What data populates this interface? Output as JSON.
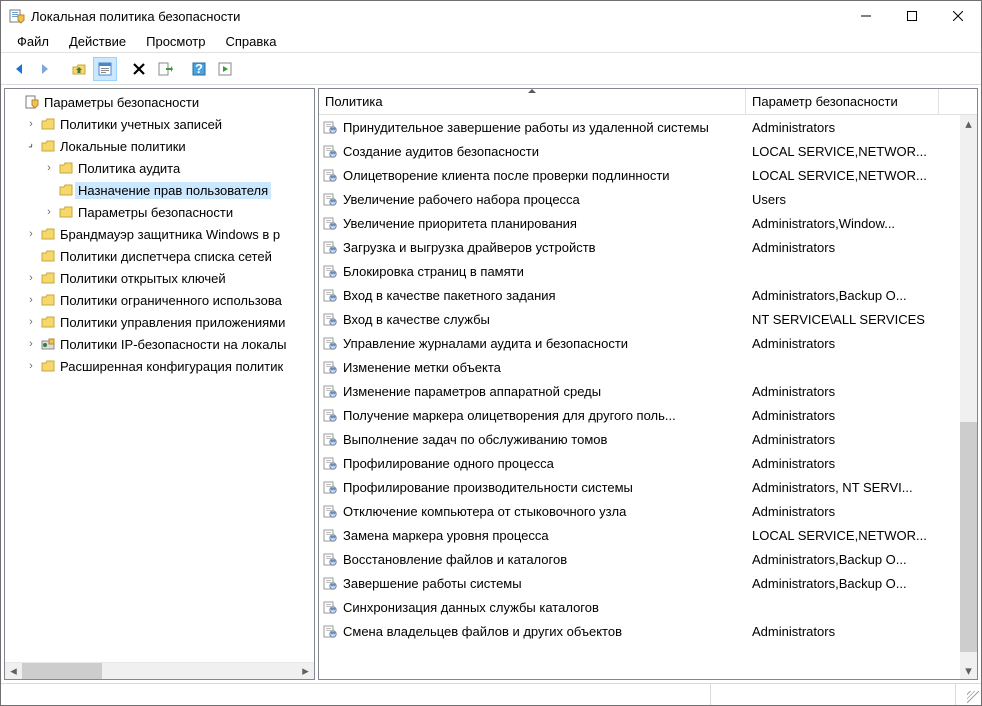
{
  "window": {
    "title": "Локальная политика безопасности"
  },
  "menu": {
    "file": "Файл",
    "action": "Действие",
    "view": "Просмотр",
    "help": "Справка"
  },
  "columns": {
    "policy": "Политика",
    "param": "Параметр безопасности",
    "policy_width": 427,
    "param_width": 193
  },
  "tree": {
    "root": "Параметры безопасности",
    "account_policies": "Политики учетных записей",
    "local_policies": "Локальные политики",
    "audit_policy": "Политика аудита",
    "user_rights": "Назначение прав пользователя",
    "security_options": "Параметры безопасности",
    "firewall": "Брандмауэр защитника Windows в р",
    "nlm": "Политики диспетчера списка сетей",
    "pk": "Политики открытых ключей",
    "srp": "Политики ограниченного использова",
    "acr": "Политики управления приложениями",
    "ipsec": "Политики IP-безопасности на локалы",
    "adv": "Расширенная конфигурация политик"
  },
  "policies": [
    {
      "name": "Принудительное завершение работы из удаленной системы",
      "value": "Administrators"
    },
    {
      "name": "Создание аудитов безопасности",
      "value": "LOCAL SERVICE,NETWOR..."
    },
    {
      "name": "Олицетворение клиента после проверки подлинности",
      "value": "LOCAL SERVICE,NETWOR..."
    },
    {
      "name": "Увеличение рабочего набора процесса",
      "value": "Users"
    },
    {
      "name": "Увеличение приоритета планирования",
      "value": "Administrators,Window..."
    },
    {
      "name": "Загрузка и выгрузка драйверов устройств",
      "value": "Administrators"
    },
    {
      "name": "Блокировка страниц в памяти",
      "value": ""
    },
    {
      "name": "Вход в качестве пакетного задания",
      "value": "Administrators,Backup O..."
    },
    {
      "name": "Вход в качестве службы",
      "value": "NT SERVICE\\ALL SERVICES"
    },
    {
      "name": "Управление журналами аудита и безопасности",
      "value": "Administrators"
    },
    {
      "name": "Изменение метки объекта",
      "value": ""
    },
    {
      "name": "Изменение параметров аппаратной среды",
      "value": "Administrators"
    },
    {
      "name": "Получение маркера олицетворения для другого поль...",
      "value": "Administrators"
    },
    {
      "name": "Выполнение задач по обслуживанию томов",
      "value": "Administrators"
    },
    {
      "name": "Профилирование одного процесса",
      "value": "Administrators"
    },
    {
      "name": "Профилирование производительности системы",
      "value": "Administrators, NT SERVI..."
    },
    {
      "name": "Отключение компьютера от стыковочного узла",
      "value": "Administrators"
    },
    {
      "name": "Замена маркера уровня процесса",
      "value": "LOCAL SERVICE,NETWOR..."
    },
    {
      "name": "Восстановление файлов и каталогов",
      "value": "Administrators,Backup O..."
    },
    {
      "name": "Завершение работы системы",
      "value": "Administrators,Backup O..."
    },
    {
      "name": "Синхронизация данных службы каталогов",
      "value": ""
    },
    {
      "name": "Смена владельцев файлов и других объектов",
      "value": "Administrators"
    }
  ]
}
